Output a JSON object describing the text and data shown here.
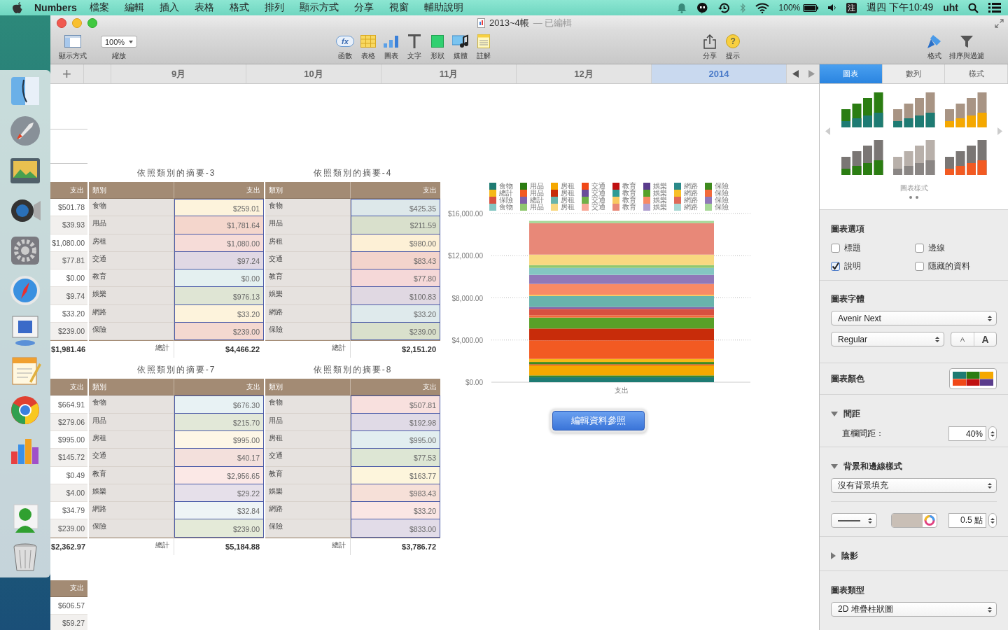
{
  "menu_bar": {
    "app": "Numbers",
    "items": [
      "檔案",
      "編輯",
      "插入",
      "表格",
      "格式",
      "排列",
      "顯示方式",
      "分享",
      "視窗",
      "輔助說明"
    ],
    "battery": "100%",
    "input_method": "注",
    "clock": "週四 下午10:49",
    "user": "uht"
  },
  "window": {
    "title": "2013~4帳",
    "status": "— 已編輯"
  },
  "toolbar": {
    "items": [
      {
        "kind": "view",
        "label": "顯示方式"
      },
      {
        "kind": "zoom",
        "label": "縮放",
        "value": "100%"
      },
      {
        "kind": "function",
        "label": "函數",
        "glyph": "fx"
      },
      {
        "kind": "table",
        "label": "表格"
      },
      {
        "kind": "chart",
        "label": "圖表"
      },
      {
        "kind": "text",
        "label": "文字"
      },
      {
        "kind": "shape",
        "label": "形狀"
      },
      {
        "kind": "media",
        "label": "媒體"
      },
      {
        "kind": "comment",
        "label": "註解"
      },
      {
        "kind": "share",
        "label": "分享"
      },
      {
        "kind": "tips",
        "label": "提示",
        "glyph": "?"
      },
      {
        "kind": "format",
        "label": "格式"
      },
      {
        "kind": "sort",
        "label": "排序與過濾"
      }
    ]
  },
  "sheets": {
    "add": "+",
    "tabs": [
      {
        "label": "9月",
        "selected": false
      },
      {
        "label": "10月",
        "selected": false
      },
      {
        "label": "11月",
        "selected": false
      },
      {
        "label": "12月",
        "selected": false
      },
      {
        "label": "2014",
        "selected": true
      }
    ]
  },
  "side_columns": [
    {
      "header": "支出",
      "values": [
        "$501.78",
        "$39.93",
        "$1,080.00",
        "$77.81",
        "$0.00",
        "$9.74",
        "$33.20",
        "$239.00"
      ],
      "total": "$1,981.46"
    },
    {
      "header": "支出",
      "values": [
        "$664.91",
        "$279.06",
        "$995.00",
        "$145.72",
        "$0.49",
        "$4.00",
        "$34.79",
        "$239.00"
      ],
      "total": "$2,362.97"
    },
    {
      "header": "支出",
      "values": [
        "$606.57",
        "$59.27"
      ]
    }
  ],
  "tables": [
    {
      "title": "依照類別的摘要-3",
      "columns": [
        "類別",
        "支出"
      ],
      "total_label": "總計",
      "total": "$4,466.22",
      "rows": [
        {
          "category": "食物",
          "amount": "$259.01",
          "color": "#fdf3dc"
        },
        {
          "category": "用品",
          "amount": "$1,781.64",
          "color": "#f4d6cc"
        },
        {
          "category": "房租",
          "amount": "$1,080.00",
          "color": "#f6dcd8"
        },
        {
          "category": "交通",
          "amount": "$97.24",
          "color": "#e0d8e4"
        },
        {
          "category": "教育",
          "amount": "$0.00",
          "color": "#e4f0f0"
        },
        {
          "category": "娛樂",
          "amount": "$976.13",
          "color": "#dfe5d4"
        },
        {
          "category": "網路",
          "amount": "$33.20",
          "color": "#fdf3dc"
        },
        {
          "category": "保險",
          "amount": "$239.00",
          "color": "#f4d8d0"
        }
      ]
    },
    {
      "title": "依照類別的摘要-4",
      "columns": [
        "類別",
        "支出"
      ],
      "total_label": "總計",
      "total": "$2,151.20",
      "rows": [
        {
          "category": "食物",
          "amount": "$425.35",
          "color": "#dde8ea"
        },
        {
          "category": "用品",
          "amount": "$211.59",
          "color": "#d9e0cc"
        },
        {
          "category": "房租",
          "amount": "$980.00",
          "color": "#fdf0d6"
        },
        {
          "category": "交通",
          "amount": "$83.43",
          "color": "#f3d4cc"
        },
        {
          "category": "教育",
          "amount": "$77.80",
          "color": "#f5d8d8"
        },
        {
          "category": "娛樂",
          "amount": "$100.83",
          "color": "#e0d8e2"
        },
        {
          "category": "網路",
          "amount": "$33.20",
          "color": "#dfeaec"
        },
        {
          "category": "保險",
          "amount": "$239.00",
          "color": "#d9e0cc"
        }
      ]
    },
    {
      "title": "依照類別的摘要-7",
      "columns": [
        "類別",
        "支出"
      ],
      "total_label": "總計",
      "total": "$5,184.88",
      "rows": [
        {
          "category": "食物",
          "amount": "$676.30",
          "color": "#e8f2f4"
        },
        {
          "category": "用品",
          "amount": "$215.70",
          "color": "#e2e8d8"
        },
        {
          "category": "房租",
          "amount": "$995.00",
          "color": "#fdf6e6"
        },
        {
          "category": "交通",
          "amount": "$40.17",
          "color": "#f3e0dc"
        },
        {
          "category": "教育",
          "amount": "$2,956.65",
          "color": "#fbe8e6"
        },
        {
          "category": "娛樂",
          "amount": "$29.22",
          "color": "#e6e0ea"
        },
        {
          "category": "網路",
          "amount": "$32.84",
          "color": "#eef4f6"
        },
        {
          "category": "保險",
          "amount": "$239.00",
          "color": "#e4ead8"
        }
      ]
    },
    {
      "title": "依照類別的摘要-8",
      "columns": [
        "類別",
        "支出"
      ],
      "total_label": "總計",
      "total": "$3,786.72",
      "rows": [
        {
          "category": "食物",
          "amount": "$507.81",
          "color": "#f8e0de"
        },
        {
          "category": "用品",
          "amount": "$192.98",
          "color": "#e0dae6"
        },
        {
          "category": "房租",
          "amount": "$995.00",
          "color": "#e2eef0"
        },
        {
          "category": "交通",
          "amount": "$77.53",
          "color": "#dde6d4"
        },
        {
          "category": "教育",
          "amount": "$163.77",
          "color": "#fdf5dc"
        },
        {
          "category": "娛樂",
          "amount": "$983.43",
          "color": "#f6e0d8"
        },
        {
          "category": "網路",
          "amount": "$33.20",
          "color": "#fae6e4"
        },
        {
          "category": "保險",
          "amount": "$833.00",
          "color": "#e2dce8"
        }
      ]
    }
  ],
  "chart": {
    "button": "編輯資料參照",
    "chart_data": {
      "type": "bar",
      "stacked": true,
      "legend": "top",
      "grid": "y",
      "categories": [
        "支出"
      ],
      "ylim": [
        0,
        16000
      ],
      "yticks": [
        {
          "value": 0,
          "label": "$0.00"
        },
        {
          "value": 4000,
          "label": "$4,000.00"
        },
        {
          "value": 8000,
          "label": "$8,000.00"
        },
        {
          "value": 12000,
          "label": "$12,000.00"
        },
        {
          "value": 16000,
          "label": "$16,000.00"
        }
      ],
      "series": [
        {
          "name": "食物",
          "color": "#1e7b73",
          "values": [
            490
          ]
        },
        {
          "name": "用品",
          "color": "#2b7d12",
          "values": [
            150
          ]
        },
        {
          "name": "房租",
          "color": "#f5a800",
          "values": [
            950
          ]
        },
        {
          "name": "交通",
          "color": "#f04818",
          "values": [
            110
          ]
        },
        {
          "name": "教育",
          "color": "#c01010",
          "values": [
            null
          ]
        },
        {
          "name": "娛樂",
          "color": "#5a3c8c",
          "values": [
            null
          ]
        },
        {
          "name": "網路",
          "color": "#2a8a8a",
          "values": [
            null
          ]
        },
        {
          "name": "保險",
          "color": "#3e8a1e",
          "values": [
            220
          ]
        },
        {
          "name": "總計",
          "color": "#f5b818",
          "values": [
            290
          ]
        },
        {
          "name": "用品",
          "color": "#f25a22",
          "values": [
            1750
          ]
        },
        {
          "name": "房租",
          "color": "#c82c0a",
          "values": [
            1130
          ]
        },
        {
          "name": "交通",
          "color": "#6a4c9a",
          "values": [
            null
          ]
        },
        {
          "name": "教育",
          "color": "#2e9a94",
          "values": [
            null
          ]
        },
        {
          "name": "娛樂",
          "color": "#58a028",
          "values": [
            1040
          ]
        },
        {
          "name": "網路",
          "color": "#f8c028",
          "values": [
            null
          ]
        },
        {
          "name": "保險",
          "color": "#f26a3a",
          "values": [
            220
          ]
        },
        {
          "name": "保險",
          "color": "#d85040",
          "values": [
            600
          ]
        },
        {
          "name": "總計",
          "color": "#8060a8",
          "values": [
            180
          ]
        },
        {
          "name": "房租",
          "color": "#68b4ac",
          "values": [
            1040
          ]
        },
        {
          "name": "交通",
          "color": "#70b048",
          "values": [
            null
          ]
        },
        {
          "name": "教育",
          "color": "#f8c860",
          "values": [
            130
          ]
        },
        {
          "name": "娛樂",
          "color": "#f88a66",
          "values": [
            1020
          ]
        },
        {
          "name": "網路",
          "color": "#e06a58",
          "values": [
            null
          ]
        },
        {
          "name": "保險",
          "color": "#9078b8",
          "values": [
            860
          ]
        },
        {
          "name": "食物",
          "color": "#84c6c2",
          "values": [
            660
          ]
        },
        {
          "name": "用品",
          "color": "#90c870",
          "values": [
            270
          ]
        },
        {
          "name": "房租",
          "color": "#f8d880",
          "values": [
            990
          ]
        },
        {
          "name": "交通",
          "color": "#f8a898",
          "values": [
            null
          ]
        },
        {
          "name": "教育",
          "color": "#e88878",
          "values": [
            2980
          ]
        },
        {
          "name": "娛樂",
          "color": "#b0a0d0",
          "values": [
            null
          ]
        },
        {
          "name": "網路",
          "color": "#a8d8d4",
          "values": [
            null
          ]
        },
        {
          "name": "保險",
          "color": "#a8d898",
          "values": [
            220
          ]
        }
      ]
    }
  },
  "inspector": {
    "tabs": [
      {
        "label": "圖表",
        "selected": true
      },
      {
        "label": "數列",
        "selected": false
      },
      {
        "label": "樣式",
        "selected": false
      }
    ],
    "styles_label": "圖表樣式",
    "options": {
      "title": "圖表選項",
      "checkboxes": [
        {
          "label": "標題",
          "checked": false
        },
        {
          "label": "邊線",
          "checked": false
        },
        {
          "label": "說明",
          "checked": true
        },
        {
          "label": "隱藏的資料",
          "checked": false
        }
      ]
    },
    "font": {
      "title": "圖表字體",
      "family": "Avenir Next",
      "style": "Regular",
      "smaller": "A",
      "larger": "A"
    },
    "colors": {
      "title": "圖表顏色"
    },
    "spacing": {
      "title": "間距",
      "expanded": true,
      "label": "直欄間距：",
      "value": "40%"
    },
    "background": {
      "title": "背景和邊線樣式",
      "expanded": true,
      "fill": "沒有背景填充",
      "stroke_width": "0.5 點"
    },
    "shadow": {
      "title": "陰影",
      "expanded": false
    },
    "chart_type": {
      "title": "圖表類型",
      "value": "2D 堆疊柱狀圖"
    }
  }
}
